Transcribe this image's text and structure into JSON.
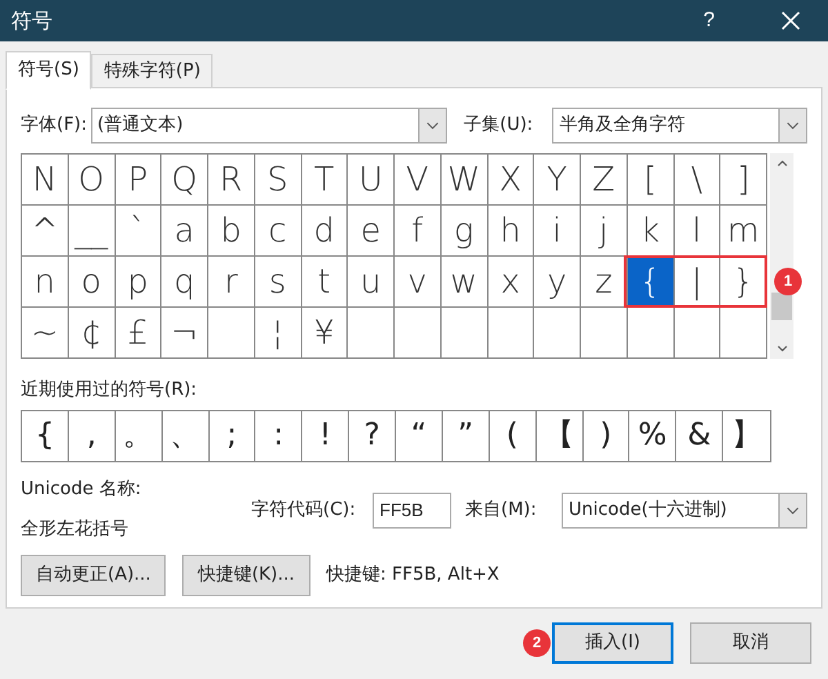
{
  "window": {
    "title": "符号",
    "help": "?"
  },
  "tabs": [
    {
      "label": "符号(S)",
      "selected": true
    },
    {
      "label": "特殊字符(P)",
      "selected": false
    }
  ],
  "font": {
    "label": "字体(F):",
    "value": "(普通文本)"
  },
  "subset": {
    "label": "子集(U):",
    "value": "半角及全角字符"
  },
  "grid": [
    [
      {
        "char": "N",
        "selected": false
      },
      {
        "char": "O",
        "selected": false
      },
      {
        "char": "P",
        "selected": false
      },
      {
        "char": "Q",
        "selected": false
      },
      {
        "char": "R",
        "selected": false
      },
      {
        "char": "S",
        "selected": false
      },
      {
        "char": "T",
        "selected": false
      },
      {
        "char": "U",
        "selected": false
      },
      {
        "char": "V",
        "selected": false
      },
      {
        "char": "W",
        "selected": false
      },
      {
        "char": "X",
        "selected": false
      },
      {
        "char": "Y",
        "selected": false
      },
      {
        "char": "Z",
        "selected": false
      },
      {
        "char": "[",
        "selected": false
      },
      {
        "char": "\\",
        "selected": false
      },
      {
        "char": "]",
        "selected": false
      }
    ],
    [
      {
        "char": "^",
        "selected": false
      },
      {
        "char": "__",
        "selected": false
      },
      {
        "char": "`",
        "selected": false
      },
      {
        "char": "a",
        "selected": false
      },
      {
        "char": "b",
        "selected": false
      },
      {
        "char": "c",
        "selected": false
      },
      {
        "char": "d",
        "selected": false
      },
      {
        "char": "e",
        "selected": false
      },
      {
        "char": "f",
        "selected": false
      },
      {
        "char": "g",
        "selected": false
      },
      {
        "char": "h",
        "selected": false
      },
      {
        "char": "i",
        "selected": false
      },
      {
        "char": "j",
        "selected": false
      },
      {
        "char": "k",
        "selected": false
      },
      {
        "char": "l",
        "selected": false
      },
      {
        "char": "m",
        "selected": false
      }
    ],
    [
      {
        "char": "n",
        "selected": false
      },
      {
        "char": "o",
        "selected": false
      },
      {
        "char": "p",
        "selected": false
      },
      {
        "char": "q",
        "selected": false
      },
      {
        "char": "r",
        "selected": false
      },
      {
        "char": "s",
        "selected": false
      },
      {
        "char": "t",
        "selected": false
      },
      {
        "char": "u",
        "selected": false
      },
      {
        "char": "v",
        "selected": false
      },
      {
        "char": "w",
        "selected": false
      },
      {
        "char": "x",
        "selected": false
      },
      {
        "char": "y",
        "selected": false
      },
      {
        "char": "z",
        "selected": false
      },
      {
        "char": "{",
        "selected": true
      },
      {
        "char": "|",
        "selected": false
      },
      {
        "char": "}",
        "selected": false
      }
    ],
    [
      {
        "char": "~",
        "selected": false
      },
      {
        "char": "¢",
        "selected": false
      },
      {
        "char": "£",
        "selected": false
      },
      {
        "char": "¬",
        "selected": false
      },
      {
        "selected": false
      },
      {
        "char": "¦",
        "selected": false
      },
      {
        "char": "¥",
        "selected": false
      },
      {
        "selected": false
      },
      {
        "selected": false
      },
      {
        "selected": false
      },
      {
        "selected": false
      },
      {
        "selected": false
      },
      {
        "selected": false
      },
      {
        "selected": false
      },
      {
        "selected": false
      },
      {
        "selected": false
      }
    ]
  ],
  "recent_label": "近期使用过的符号(R):",
  "recent": [
    "{",
    ",",
    "。",
    "、",
    ";",
    ":",
    "!",
    "?",
    "“",
    "”",
    "(",
    "【",
    ")",
    "%",
    "&",
    "】"
  ],
  "unicode_name_label": "Unicode 名称:",
  "unicode_name": "全形左花括号",
  "char_code": {
    "label": "字符代码(C):",
    "value": "FF5B"
  },
  "from": {
    "label": "来自(M):",
    "value": "Unicode(十六进制)"
  },
  "buttons": [
    {
      "label": "自动更正(A)..."
    },
    {
      "label": "快捷键(K)..."
    }
  ],
  "shortcut_text": "快捷键: FF5B, Alt+X",
  "footer_buttons": [
    {
      "label": "插入(I)",
      "default": true
    },
    {
      "label": "取消",
      "default": false
    }
  ],
  "annotations": [
    {
      "label": "1"
    },
    {
      "label": "2"
    }
  ]
}
